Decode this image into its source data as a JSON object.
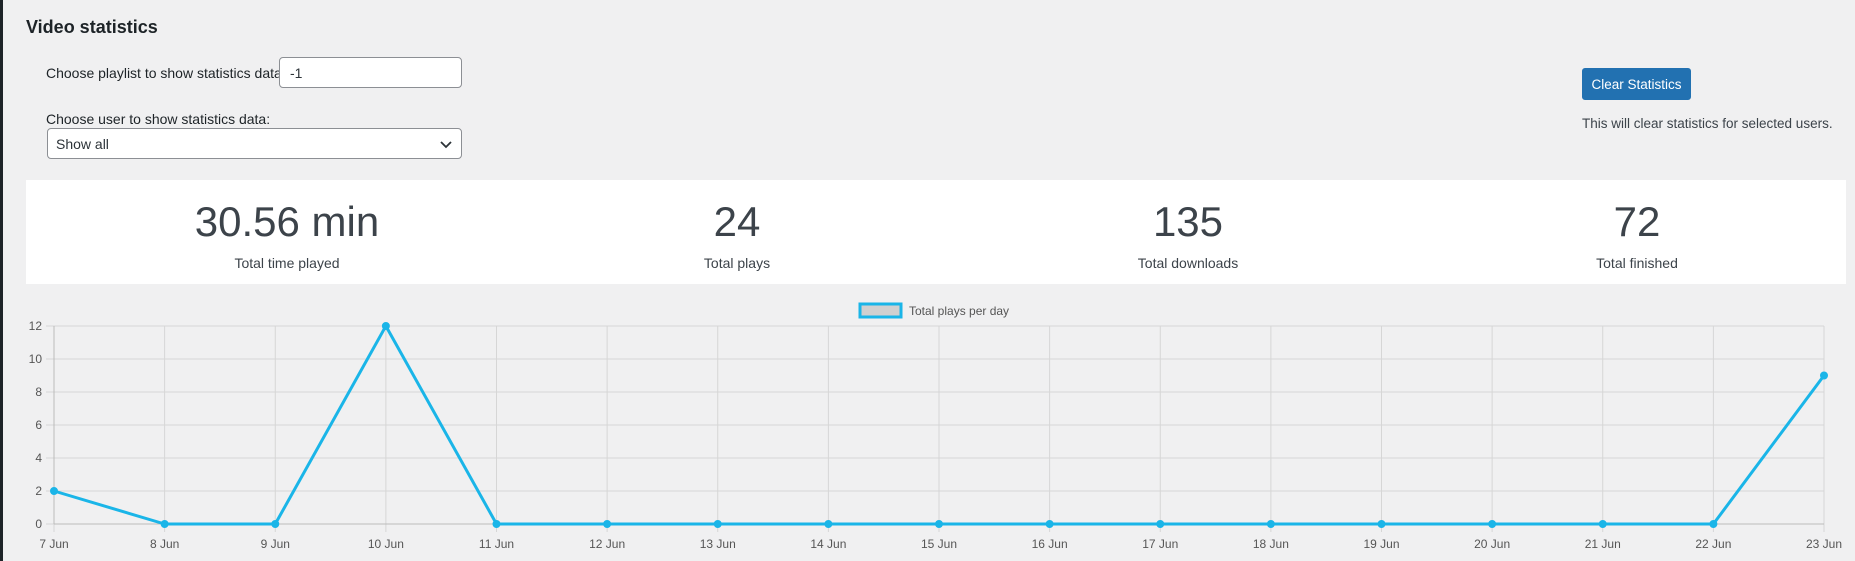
{
  "page": {
    "title": "Video statistics"
  },
  "filters": {
    "playlist_label": "Choose playlist to show statistics data:",
    "playlist_value": "-1",
    "user_label": "Choose user to show statistics data:",
    "user_selected": "Show all"
  },
  "actions": {
    "clear_label": "Clear Statistics",
    "clear_note": "This will clear statistics for selected users."
  },
  "stats": [
    {
      "value": "30.56 min",
      "label": "Total time played"
    },
    {
      "value": "24",
      "label": "Total plays"
    },
    {
      "value": "135",
      "label": "Total downloads"
    },
    {
      "value": "72",
      "label": "Total finished"
    }
  ],
  "colors": {
    "accent": "#2271b1",
    "series": "#1ab5e8",
    "grid": "#d6d6d6"
  },
  "chart_data": {
    "type": "line",
    "categories": [
      "7 Jun",
      "8 Jun",
      "9 Jun",
      "10 Jun",
      "11 Jun",
      "12 Jun",
      "13 Jun",
      "14 Jun",
      "15 Jun",
      "16 Jun",
      "17 Jun",
      "18 Jun",
      "19 Jun",
      "20 Jun",
      "21 Jun",
      "22 Jun",
      "23 Jun"
    ],
    "series": [
      {
        "name": "Total plays per day",
        "values": [
          2,
          0,
          0,
          12,
          0,
          0,
          0,
          0,
          0,
          0,
          0,
          0,
          0,
          0,
          0,
          0,
          9
        ]
      }
    ],
    "yticks": [
      0,
      2,
      4,
      6,
      8,
      10,
      12
    ],
    "ylim": [
      0,
      12
    ],
    "grid": true,
    "legend": "top-center"
  }
}
